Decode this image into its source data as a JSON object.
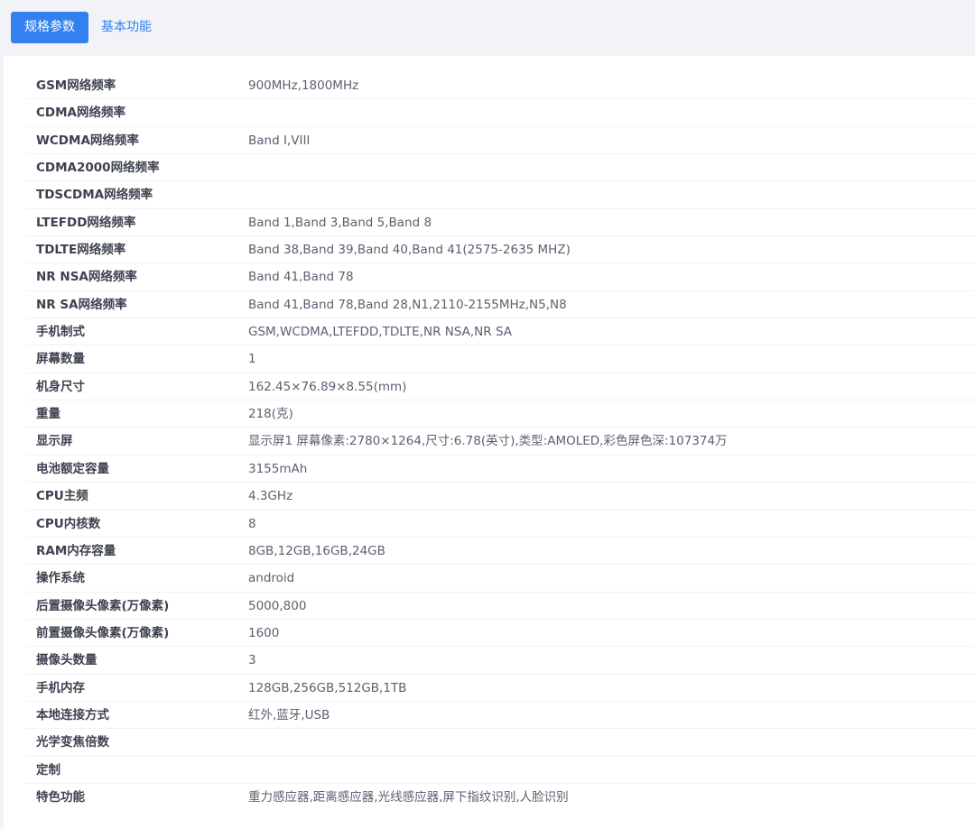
{
  "tabs": {
    "active_label": "规格参数",
    "inactive_label": "基本功能"
  },
  "specs": [
    {
      "label": "GSM网络频率",
      "value": "900MHz,1800MHz"
    },
    {
      "label": "CDMA网络频率",
      "value": ""
    },
    {
      "label": "WCDMA网络频率",
      "value": "Band I,VIII"
    },
    {
      "label": "CDMA2000网络频率",
      "value": ""
    },
    {
      "label": "TDSCDMA网络频率",
      "value": ""
    },
    {
      "label": "LTEFDD网络频率",
      "value": "Band 1,Band 3,Band 5,Band 8"
    },
    {
      "label": "TDLTE网络频率",
      "value": "Band 38,Band 39,Band 40,Band 41(2575-2635 MHZ)"
    },
    {
      "label": "NR NSA网络频率",
      "value": "Band 41,Band 78"
    },
    {
      "label": "NR SA网络频率",
      "value": "Band 41,Band 78,Band 28,N1,2110-2155MHz,N5,N8"
    },
    {
      "label": "手机制式",
      "value": "GSM,WCDMA,LTEFDD,TDLTE,NR NSA,NR SA"
    },
    {
      "label": "屏幕数量",
      "value": "1"
    },
    {
      "label": "机身尺寸",
      "value": "162.45×76.89×8.55(mm)"
    },
    {
      "label": "重量",
      "value": "218(克)"
    },
    {
      "label": "显示屏",
      "value": "显示屏1 屏幕像素:2780×1264,尺寸:6.78(英寸),类型:AMOLED,彩色屏色深:107374万"
    },
    {
      "label": "电池额定容量",
      "value": "3155mAh"
    },
    {
      "label": "CPU主频",
      "value": "4.3GHz"
    },
    {
      "label": "CPU内核数",
      "value": "8"
    },
    {
      "label": "RAM内存容量",
      "value": "8GB,12GB,16GB,24GB"
    },
    {
      "label": "操作系统",
      "value": "android"
    },
    {
      "label": "后置摄像头像素(万像素)",
      "value": "5000,800"
    },
    {
      "label": "前置摄像头像素(万像素)",
      "value": "1600"
    },
    {
      "label": "摄像头数量",
      "value": "3"
    },
    {
      "label": "手机内存",
      "value": "128GB,256GB,512GB,1TB"
    },
    {
      "label": "本地连接方式",
      "value": "红外,蓝牙,USB"
    },
    {
      "label": "光学变焦倍数",
      "value": ""
    },
    {
      "label": "定制",
      "value": ""
    },
    {
      "label": "特色功能",
      "value": "重力感应器,距离感应器,光线感应器,屏下指纹识别,人脸识别"
    }
  ]
}
